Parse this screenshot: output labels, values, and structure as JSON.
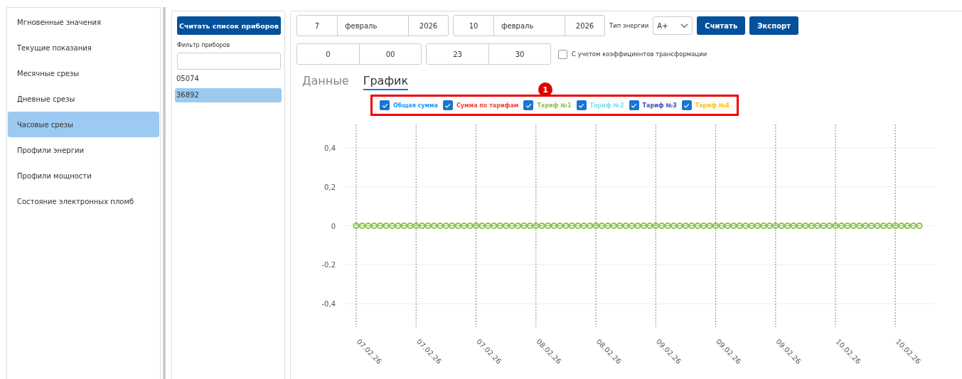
{
  "sidebar": {
    "items": [
      {
        "label": "Мгновенные значения",
        "selected": false
      },
      {
        "label": "Текущие показания",
        "selected": false
      },
      {
        "label": "Месячные срезы",
        "selected": false
      },
      {
        "label": "Дневные срезы",
        "selected": false
      },
      {
        "label": "Часовые срезы",
        "selected": true
      },
      {
        "label": "Профили энергии",
        "selected": false
      },
      {
        "label": "Профили мощности",
        "selected": false
      },
      {
        "label": "Состояние электронных пломб",
        "selected": false
      }
    ]
  },
  "devices": {
    "read_button": "Считать список приборов",
    "filter_label": "Фильтр приборов",
    "items": [
      {
        "label": "05074",
        "selected": false
      },
      {
        "label": "36892",
        "selected": true
      }
    ]
  },
  "controls": {
    "date_from": [
      "7",
      "февраль",
      "2026"
    ],
    "date_to": [
      "10",
      "февраль",
      "2026"
    ],
    "energy_type_label": "Тип энергии",
    "energy_type": "A+",
    "buttons": [
      "Считать",
      "Экспорт"
    ],
    "time_from": [
      "0",
      "00"
    ],
    "time_to": [
      "23",
      "30"
    ],
    "transform_coefficients": {
      "label": "С учетом коэффициентов трансформации",
      "checked": false
    }
  },
  "tabs": [
    {
      "label": "Данные",
      "selected": false
    },
    {
      "label": "График",
      "selected": true
    }
  ],
  "legend": [
    {
      "label": "Общая сумма",
      "checked": true,
      "color": "#2196f3"
    },
    {
      "label": "Сумма по тарифам",
      "checked": true,
      "color": "#f44336"
    },
    {
      "label": "Тариф №1",
      "checked": true,
      "color": "#8bc34a"
    },
    {
      "label": "Тариф №2",
      "checked": true,
      "color": "#80deea"
    },
    {
      "label": "Тариф №3",
      "checked": true,
      "color": "#3f51b5"
    },
    {
      "label": "Тариф №4",
      "checked": true,
      "color": "#ffc107"
    }
  ],
  "callout": {
    "number": "1"
  },
  "chart_data": {
    "type": "line",
    "grid": true,
    "ylim": [
      -0.52,
      0.52
    ],
    "categories": [
      "07.02.26",
      null,
      null,
      null,
      null,
      null,
      null,
      null,
      null,
      null,
      "07.02.26",
      null,
      null,
      null,
      null,
      null,
      null,
      null,
      null,
      null,
      "07.02.26",
      null,
      null,
      null,
      null,
      null,
      null,
      null,
      null,
      null,
      "08.02.26",
      null,
      null,
      null,
      null,
      null,
      null,
      null,
      null,
      null,
      "08.02.26",
      null,
      null,
      null,
      null,
      null,
      null,
      null,
      null,
      null,
      "09.02.26",
      null,
      null,
      null,
      null,
      null,
      null,
      null,
      null,
      null,
      "09.02.26",
      null,
      null,
      null,
      null,
      null,
      null,
      null,
      null,
      null,
      "09.02.26",
      null,
      null,
      null,
      null,
      null,
      null,
      null,
      null,
      null,
      "10.02.26",
      null,
      null,
      null,
      null,
      null,
      null,
      null,
      null,
      null,
      "10.02.26",
      null,
      null,
      null,
      null
    ],
    "yticks": [
      {
        "value": -0.4,
        "label": "-0,4"
      },
      {
        "value": -0.2,
        "label": "-0,2"
      },
      {
        "value": 0,
        "label": "0"
      },
      {
        "value": 0.2,
        "label": "0,2"
      },
      {
        "value": 0.4,
        "label": "0,4"
      }
    ],
    "series": [
      {
        "color": "#8bc34a",
        "marker": "circle",
        "values": [
          0,
          0,
          0,
          0,
          0,
          0,
          0,
          0,
          0,
          0,
          0,
          0,
          0,
          0,
          0,
          0,
          0,
          0,
          0,
          0,
          0,
          0,
          0,
          0,
          0,
          0,
          0,
          0,
          0,
          0,
          0,
          0,
          0,
          0,
          0,
          0,
          0,
          0,
          0,
          0,
          0,
          0,
          0,
          0,
          0,
          0,
          0,
          0,
          0,
          0,
          0,
          0,
          0,
          0,
          0,
          0,
          0,
          0,
          0,
          0,
          0,
          0,
          0,
          0,
          0,
          0,
          0,
          0,
          0,
          0,
          0,
          0,
          0,
          0,
          0,
          0,
          0,
          0,
          0,
          0,
          0,
          0,
          0,
          0,
          0,
          0,
          0,
          0,
          0,
          0,
          0,
          0,
          0,
          0,
          0
        ]
      }
    ]
  }
}
